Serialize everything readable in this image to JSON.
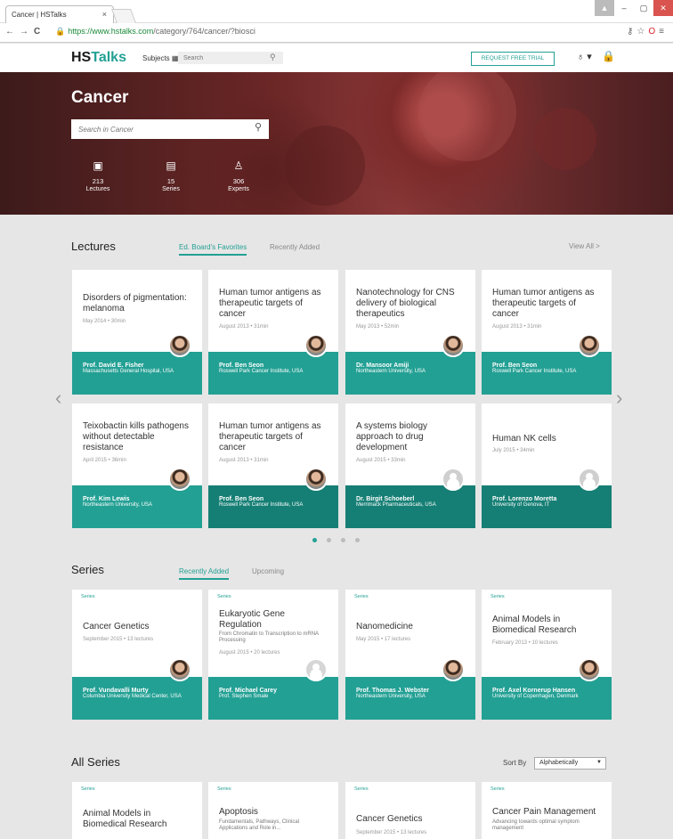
{
  "browser": {
    "tab_title": "Cancer | HSTalks",
    "tab_close": "×",
    "url_secure": "https://www.hstalks.com",
    "url_path": "/category/764/cancer/?biosci",
    "back": "←",
    "forward": "→",
    "reload": "C"
  },
  "header": {
    "logo_main": "HS",
    "logo_accent": "Talks",
    "subjects_label": "Subjects ▦",
    "search_placeholder": "Search",
    "trial_button": "REQUEST FREE TRIAL"
  },
  "hero": {
    "title": "Cancer",
    "search_placeholder": "Search in Cancer",
    "stats": [
      {
        "number": "213",
        "label": "Lectures"
      },
      {
        "number": "15",
        "label": "Series"
      },
      {
        "number": "306",
        "label": "Experts"
      }
    ]
  },
  "lectures": {
    "title": "Lectures",
    "tabs": [
      "Ed. Board's Favorites",
      "Recently Added"
    ],
    "view_all": "View All >",
    "cards": [
      {
        "title": "Disorders of pigmentation: melanoma",
        "meta": "May 2014 • 30min",
        "name": "Prof. David E. Fisher",
        "aff": "Massachusetts General Hospital, USA"
      },
      {
        "title": "Human tumor antigens as therapeutic targets of cancer",
        "meta": "August 2013 • 31min",
        "name": "Prof. Ben Seon",
        "aff": "Roswell Park Cancer Institute, USA"
      },
      {
        "title": "Nanotechnology for CNS delivery of biological therapeutics",
        "meta": "May 2013 • 52min",
        "name": "Dr. Mansoor Amiji",
        "aff": "Northeastern University, USA"
      },
      {
        "title": "Human tumor antigens as therapeutic targets of cancer",
        "meta": "August 2013 • 31min",
        "name": "Prof. Ben Seon",
        "aff": "Roswell Park Cancer Institute, USA"
      },
      {
        "title": "Teixobactin kills pathogens without detectable resistance",
        "meta": "April 2015 • 36min",
        "name": "Prof. Kim Lewis",
        "aff": "Northeastern University, USA"
      },
      {
        "title": "Human tumor antigens as therapeutic targets of cancer",
        "meta": "August 2013 • 31min",
        "name": "Prof. Ben Seon",
        "aff": "Roswell Park Cancer Institute, USA"
      },
      {
        "title": "A systems biology approach to drug development",
        "meta": "August 2015 • 33min",
        "name": "Dr. Birgit Schoeberl",
        "aff": "Merrimack Pharmaceuticals, USA"
      },
      {
        "title": "Human NK cells",
        "meta": "July 2015 • 34min",
        "name": "Prof. Lorenzo Moretta",
        "aff": "University of Genova, IT"
      }
    ]
  },
  "series": {
    "title": "Series",
    "tabs": [
      "Recently Added",
      "Upcoming"
    ],
    "tag": "Series",
    "cards": [
      {
        "title": "Cancer Genetics",
        "sub": "",
        "meta": "September 2015 • 13 lectures",
        "name": "Prof. Vundavalli Murty",
        "aff": "Columbia University Medical Center, USA"
      },
      {
        "title": "Eukaryotic Gene Regulation",
        "sub": "From Chromatin to Transcription to mRNA Processing",
        "meta": "August 2015 • 20 lectures",
        "name": "Prof. Michael Carey",
        "aff": "Prof. Stephen Smale"
      },
      {
        "title": "Nanomedicine",
        "sub": "",
        "meta": "May 2015 • 17 lectures",
        "name": "Prof. Thomas J. Webster",
        "aff": "Northeastern University, USA"
      },
      {
        "title": "Animal Models in Biomedical Research",
        "sub": "",
        "meta": "February 2013 • 10 lectures",
        "name": "Prof. Axel Kornerup Hansen",
        "aff": "University of Copenhagen, Denmark"
      }
    ]
  },
  "all_series": {
    "title": "All Series",
    "sort_label": "Sort By",
    "sort_value": "Alphabetically",
    "cards": [
      {
        "title": "Animal Models in Biomedical Research",
        "sub": ""
      },
      {
        "title": "Apoptosis",
        "sub": "Fundamentals, Pathways, Clinical Applications and Role in..."
      },
      {
        "title": "Cancer Genetics",
        "sub": "",
        "meta": "September 2015 • 13 lectures"
      },
      {
        "title": "Cancer Pain Management",
        "sub": "Advancing towards optimal symptom management"
      }
    ]
  },
  "colors": {
    "accent": "#23a094",
    "accent_dark": "#167f75"
  }
}
